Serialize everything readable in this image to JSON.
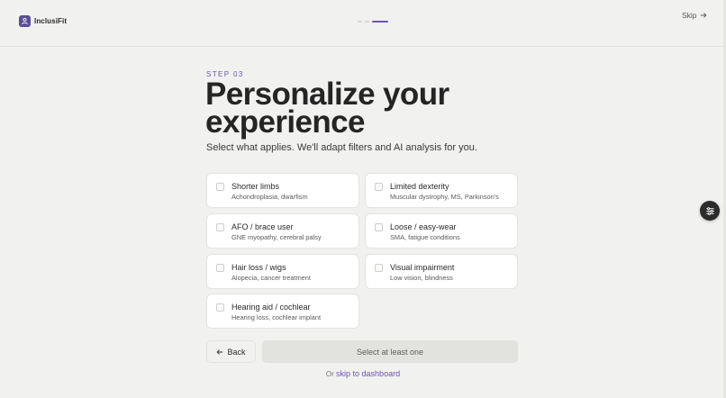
{
  "brand": {
    "name": "InclusiFit",
    "logo_icon": "person-icon",
    "accent": "#6b55b5"
  },
  "progress": {
    "current_step": 3,
    "total_steps": 3
  },
  "header": {
    "skip_label": "Skip",
    "skip_icon": "arrow-right-icon"
  },
  "main": {
    "step_label": "STEP 03",
    "title": "Personalize your experience",
    "subtitle": "Select what applies. We'll adapt filters and AI analysis for you.",
    "options": [
      {
        "title": "Shorter limbs",
        "subtitle": "Achondroplasia, dwarfism",
        "checked": false
      },
      {
        "title": "Limited dexterity",
        "subtitle": "Muscular dystrophy, MS, Parkinson's",
        "checked": false
      },
      {
        "title": "AFO / brace user",
        "subtitle": "GNE myopathy, cerebral palsy",
        "checked": false
      },
      {
        "title": "Loose / easy-wear",
        "subtitle": "SMA, fatigue conditions",
        "checked": false
      },
      {
        "title": "Hair loss / wigs",
        "subtitle": "Alopecia, cancer treatment",
        "checked": false
      },
      {
        "title": "Visual impairment",
        "subtitle": "Low vision, blindness",
        "checked": false
      },
      {
        "title": "Hearing aid / cochlear",
        "subtitle": "Hearing loss, cochlear implant",
        "checked": false
      }
    ]
  },
  "actions": {
    "back_label": "Back",
    "back_icon": "arrow-left-icon",
    "continue_label": "Select at least one",
    "footer_prefix": "Or",
    "footer_link": "skip to dashboard"
  },
  "fab": {
    "icon": "settings-sliders-icon"
  }
}
